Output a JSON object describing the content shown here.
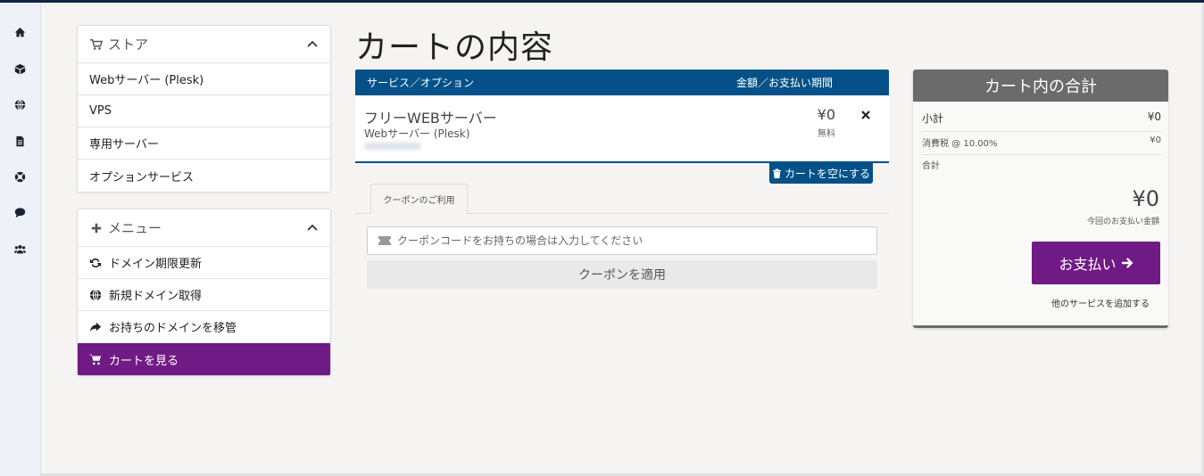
{
  "rail": {
    "icons": [
      "home-icon",
      "box-icon",
      "globe-icon",
      "document-icon",
      "lifebuoy-icon",
      "chat-icon",
      "users-icon"
    ]
  },
  "store_panel": {
    "title": "ストア",
    "items": [
      "Webサーバー (Plesk)",
      "VPS",
      "専用サーバー",
      "オプションサービス"
    ]
  },
  "menu_panel": {
    "title": "メニュー",
    "items": [
      {
        "label": "ドメイン期限更新",
        "icon": "refresh-icon"
      },
      {
        "label": "新規ドメイン取得",
        "icon": "globe-icon"
      },
      {
        "label": "お持ちのドメインを移管",
        "icon": "share-icon"
      },
      {
        "label": "カートを見る",
        "icon": "cart-icon",
        "active": true
      }
    ]
  },
  "page": {
    "title": "カートの内容"
  },
  "cart": {
    "col_service": "サービス／オプション",
    "col_price": "金額／お支払い期間",
    "item": {
      "name": "フリーWEBサーバー",
      "product": "Webサーバー (Plesk)",
      "price": "¥0",
      "cycle": "無料"
    },
    "empty_label": "カートを空にする"
  },
  "coupon": {
    "tab_label": "クーポンのご利用",
    "placeholder": "クーポンコードをお持ちの場合は入力してください",
    "apply_label": "クーポンを適用"
  },
  "summary": {
    "title": "カート内の合計",
    "subtotal_label": "小計",
    "subtotal_value": "¥0",
    "tax_label": "消費税 @ 10.00%",
    "tax_value": "¥0",
    "total_label": "合計",
    "total_value": "¥0",
    "total_note": "今回のお支払い金額",
    "checkout_label": "お支払い",
    "continue_label": "他のサービスを追加する"
  },
  "colors": {
    "primary_blue": "#035188",
    "accent_purple": "#701b85",
    "summary_gray": "#6b6b6b"
  }
}
